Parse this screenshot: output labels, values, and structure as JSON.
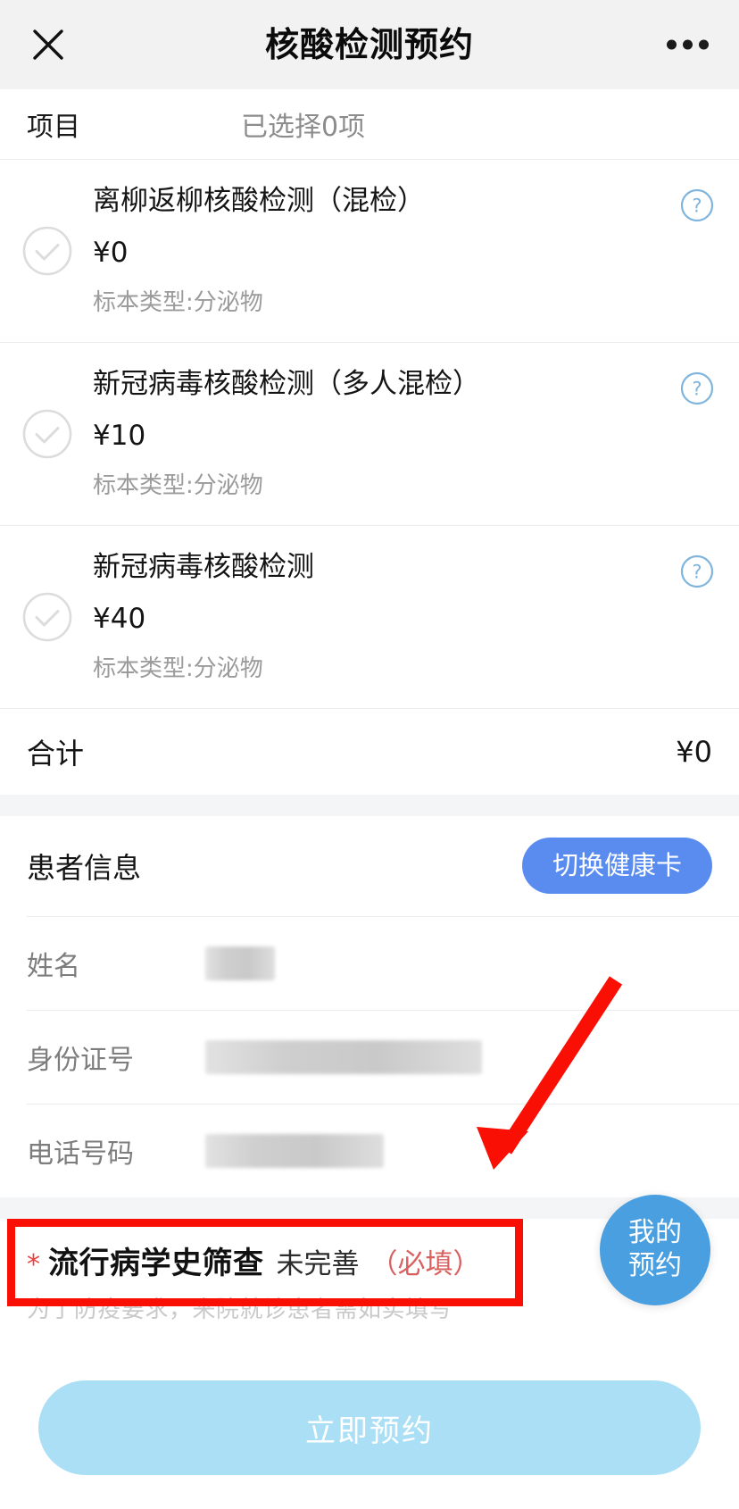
{
  "navbar": {
    "title": "核酸检测预约",
    "close_icon": "close-icon",
    "more_icon": "more-options-icon"
  },
  "project_row": {
    "label": "项目",
    "value": "已选择0项"
  },
  "items": [
    {
      "name": "离柳返柳核酸检测（混检）",
      "price": "¥0",
      "spec": "标本类型:分泌物",
      "checked": false,
      "help_icon": "question-mark-icon"
    },
    {
      "name": "新冠病毒核酸检测（多人混检）",
      "price": "¥10",
      "spec": "标本类型:分泌物",
      "checked": false,
      "help_icon": "question-mark-icon"
    },
    {
      "name": "新冠病毒核酸检测",
      "price": "¥40",
      "spec": "标本类型:分泌物",
      "checked": false,
      "help_icon": "question-mark-icon"
    }
  ],
  "total": {
    "label": "合计",
    "amount": "¥0"
  },
  "patient": {
    "section_label": "患者信息",
    "switch_card_button": "切换健康卡",
    "fields": [
      {
        "label": "姓名",
        "value": ""
      },
      {
        "label": "身份证号",
        "value": ""
      },
      {
        "label": "电话号码",
        "value": ""
      }
    ]
  },
  "epidemiology": {
    "star": "*",
    "title": "流行病学史筛查",
    "status": "未完善",
    "required": "（必填）",
    "description": "为了防疫要求，来院就诊患者需如实填写"
  },
  "fab": {
    "line1": "我的",
    "line2": "预约"
  },
  "cta": {
    "label": "立即预约"
  },
  "colors": {
    "navbar_bg": "#f2f2f2",
    "accent_blue": "#5a8cf0",
    "fab_blue": "#4a9fe0",
    "cta_disabled": "#aadff5",
    "annotation_red": "#fa0f05",
    "required_red": "#d8605f",
    "help_icon_blue": "#7fb4dd"
  }
}
